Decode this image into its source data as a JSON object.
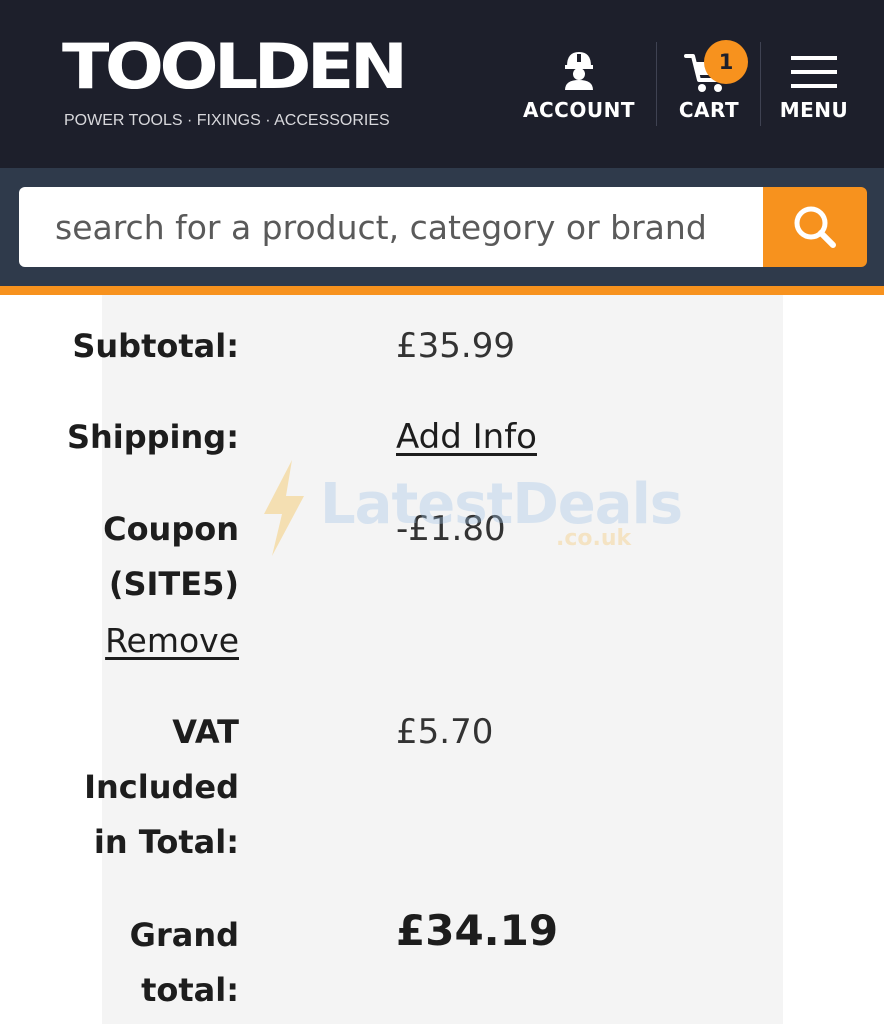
{
  "header": {
    "logo_text": "TOOLDEN",
    "tagline": "POWER TOOLS · FIXINGS · ACCESSORIES",
    "account_label": "ACCOUNT",
    "cart_label": "CART",
    "cart_count": "1",
    "menu_label": "MENU",
    "icons": {
      "account": "worker-helmet-icon",
      "cart": "cart-icon",
      "menu": "hamburger-icon",
      "search": "search-icon"
    }
  },
  "search": {
    "placeholder": "search for a product, category or brand"
  },
  "totals": {
    "subtotal_label": "Subtotal:",
    "subtotal_value": "£35.99",
    "shipping_label": "Shipping:",
    "shipping_value": "Add Info",
    "coupon_label_1": "Coupon",
    "coupon_label_2": "(SITE5)",
    "coupon_remove": "Remove",
    "coupon_value": "-£1.80",
    "vat_label_1": "VAT",
    "vat_label_2": "Included",
    "vat_label_3": "in Total:",
    "vat_value": "£5.70",
    "grand_label_1": "Grand",
    "grand_label_2": "total:",
    "grand_value": "£34.19"
  },
  "watermark": {
    "text": "LatestDeals",
    "sub": ".co.uk"
  },
  "colors": {
    "header_bg": "#1d1f2b",
    "search_band": "#2f3a4b",
    "accent": "#f7921e",
    "panel_bg": "#f4f4f4"
  }
}
